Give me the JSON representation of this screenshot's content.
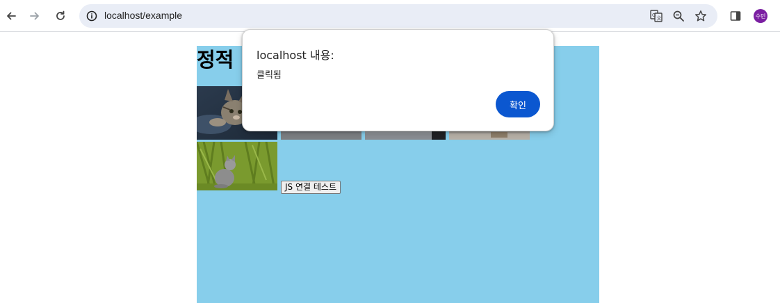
{
  "browser": {
    "url": "localhost/example",
    "profile_initials": "수민",
    "icons": {
      "back": "back-arrow-icon",
      "forward": "forward-arrow-icon",
      "reload": "reload-icon",
      "site_info": "info-icon",
      "translate": "translate-icon",
      "zoom": "zoom-out-icon",
      "bookmark": "star-icon",
      "side_panel": "side-panel-icon"
    },
    "colors": {
      "omnibox_bg": "#e9edf6",
      "avatar_bg": "#7b1fa2"
    }
  },
  "page": {
    "title": "정적",
    "background": "#87ceeb",
    "images": [
      {
        "name": "cat-image-1",
        "subject": "tabby kitten lying on blanket"
      },
      {
        "name": "cat-image-2",
        "subject": "cat photo"
      },
      {
        "name": "cat-image-3",
        "subject": "cat photo"
      },
      {
        "name": "cat-image-4",
        "subject": "cat photo"
      },
      {
        "name": "cat-image-5",
        "subject": "gray kitten sitting in grass"
      }
    ],
    "js_button_label": "JS 연결 테스트"
  },
  "dialog": {
    "title": "localhost 내용:",
    "message": "클릭됨",
    "ok_label": "확인",
    "accent": "#0b57d0"
  }
}
